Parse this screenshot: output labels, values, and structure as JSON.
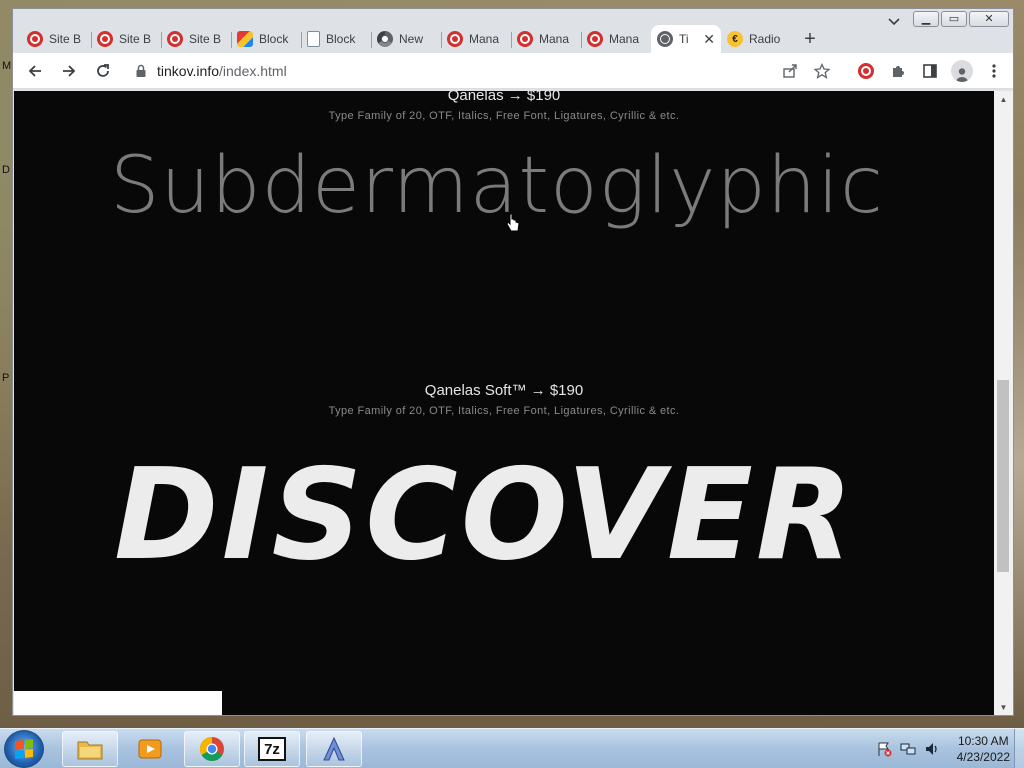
{
  "desktop": {
    "edge_letters": [
      "M",
      "D",
      "P"
    ]
  },
  "window": {
    "controls": {
      "minimize": "▁",
      "maximize": "▭",
      "close": "✕"
    }
  },
  "tabs": [
    {
      "label": "Site B",
      "icon": "ublock-icon"
    },
    {
      "label": "Site B",
      "icon": "ublock-icon"
    },
    {
      "label": "Site B",
      "icon": "ublock-icon"
    },
    {
      "label": "Block",
      "icon": "paint-icon"
    },
    {
      "label": "Block",
      "icon": "doc-icon"
    },
    {
      "label": "New",
      "icon": "chrome-icon"
    },
    {
      "label": "Mana",
      "icon": "ublock-icon"
    },
    {
      "label": "Mana",
      "icon": "ublock-icon"
    },
    {
      "label": "Mana",
      "icon": "ublock-icon"
    },
    {
      "label": "Ti",
      "icon": "globe-icon",
      "active": true
    },
    {
      "label": "Radio",
      "icon": "radio-icon"
    }
  ],
  "toolbar": {
    "url_host": "tinkov.info",
    "url_path": "/index.html"
  },
  "page": {
    "block1": {
      "title": "Qanelas   → $190",
      "subtitle": "Type Family of 20, OTF, Italics, Free Font, Ligatures, Cyrillic & etc.",
      "specimen": "Subdermatoglyphic"
    },
    "block2": {
      "title": "Qanelas Soft™ → $190",
      "subtitle": "Type Family of 20, OTF, Italics, Free Font, Ligatures, Cyrillic & etc.",
      "specimen": "DISCOVER"
    }
  },
  "taskbar": {
    "apps": [
      "file-explorer",
      "media-player",
      "chrome",
      "7-zip",
      "app-a"
    ],
    "zip_label": "7z",
    "clock_time": "10:30 AM",
    "clock_date": "4/23/2022"
  },
  "colors": {
    "page_bg": "#080808",
    "specimen_light": "#7b7b7b",
    "specimen_heavy": "#ececec",
    "ublock_red": "#d32f2f"
  }
}
